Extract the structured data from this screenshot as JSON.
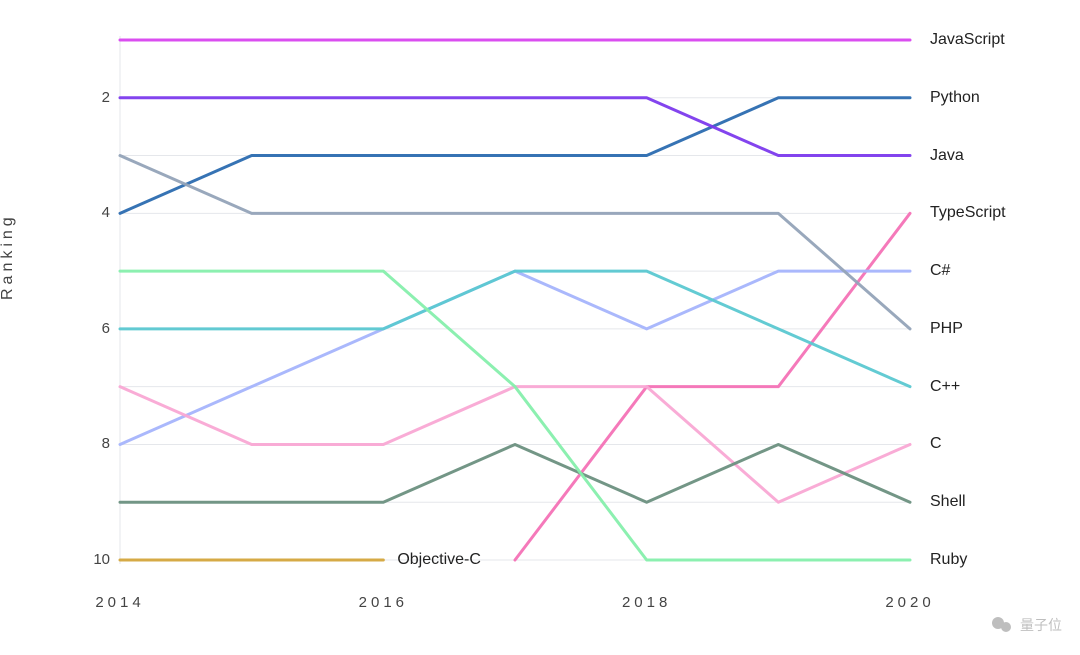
{
  "chart_data": {
    "type": "line",
    "title": "",
    "xlabel": "",
    "ylabel": "Ranking",
    "x": [
      2014,
      2015,
      2016,
      2017,
      2018,
      2019,
      2020
    ],
    "x_ticks": [
      2014,
      2016,
      2018,
      2020
    ],
    "y_ticks": [
      2,
      4,
      6,
      8,
      10
    ],
    "ylim_inverted": true,
    "series": [
      {
        "name": "JavaScript",
        "color": "#d946ef",
        "values": [
          1,
          1,
          1,
          1,
          1,
          1,
          1
        ]
      },
      {
        "name": "Python",
        "color": "#2b6cb0",
        "values": [
          4,
          3,
          3,
          3,
          3,
          2,
          2
        ]
      },
      {
        "name": "Java",
        "color": "#7c3aed",
        "values": [
          2,
          2,
          2,
          2,
          2,
          3,
          3
        ]
      },
      {
        "name": "TypeScript",
        "color": "#f472b6",
        "values": [
          null,
          null,
          null,
          10,
          7,
          7,
          4
        ]
      },
      {
        "name": "C#",
        "color": "#a5b4fc",
        "values": [
          8,
          7,
          6,
          5,
          6,
          5,
          5
        ]
      },
      {
        "name": "PHP",
        "color": "#94a3b8",
        "values": [
          3,
          4,
          4,
          4,
          4,
          4,
          6
        ]
      },
      {
        "name": "C++",
        "color": "#5bc8d1",
        "values": [
          6,
          6,
          6,
          5,
          5,
          6,
          7
        ]
      },
      {
        "name": "C",
        "color": "#f9a8d4",
        "values": [
          7,
          8,
          8,
          7,
          7,
          9,
          8
        ]
      },
      {
        "name": "Shell",
        "color": "#6b9080",
        "values": [
          9,
          9,
          9,
          8,
          9,
          8,
          9
        ]
      },
      {
        "name": "Ruby",
        "color": "#86efac",
        "values": [
          5,
          5,
          5,
          7,
          10,
          10,
          10
        ]
      },
      {
        "name": "Objective-C",
        "color": "#d4a73c",
        "values": [
          10,
          10,
          10,
          null,
          null,
          null,
          null
        ],
        "inline_label_at": 2016
      }
    ]
  },
  "watermark": {
    "text": "量子位"
  }
}
